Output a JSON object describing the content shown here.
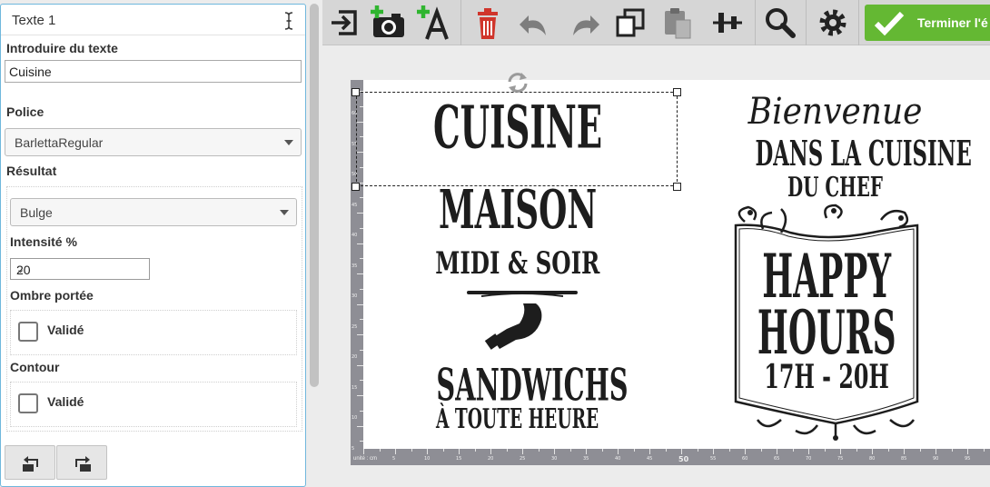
{
  "panel": {
    "title": "Texte 1",
    "text_label": "Introduire du texte",
    "text_value": "Cuisine",
    "font_label": "Police",
    "font_value": "BarlettaRegular",
    "result_label": "Résultat",
    "effect_value": "Bulge",
    "intensity_label": "Intensité %",
    "intensity_value": "20",
    "shadow_label": "Ombre portée",
    "shadow_check_label": "Validé",
    "contour_label": "Contour",
    "contour_check_label": "Validé"
  },
  "toolbar": {
    "finish_label": "Terminer l'é",
    "icons": [
      "exit-icon",
      "add-image-icon",
      "add-text-icon",
      "delete-icon",
      "undo-icon",
      "redo-icon",
      "duplicate-icon",
      "paste-icon",
      "align-icon",
      "zoom-icon",
      "settings-icon",
      "checkmark-icon"
    ]
  },
  "ruler": {
    "unit": "unité : cm",
    "bottom_labels": [
      "5",
      "10",
      "15",
      "20",
      "25",
      "30",
      "35",
      "40",
      "45",
      "50",
      "55",
      "60",
      "65",
      "70",
      "75",
      "80",
      "85",
      "90",
      "95"
    ],
    "left_labels": [
      "60",
      "55",
      "50",
      "45",
      "40",
      "35",
      "30",
      "25",
      "20",
      "15",
      "10",
      "5"
    ]
  },
  "artwork": {
    "left": {
      "line1": "CUISINE",
      "line2": "MAISON",
      "line3": "MIDI & SOIR",
      "line4": "SANDWICHS",
      "line5": "À TOUTE HEURE"
    },
    "right": {
      "script": "Bienvenue",
      "line1": "DANS LA CUISINE",
      "line2": "DU CHEF",
      "line3": "HAPPY",
      "line4": "HOURS",
      "line5": "17H - 20H"
    }
  },
  "colors": {
    "accent": "#6fb7dc",
    "finish_green": "#64b833",
    "delete_red": "#d0352b",
    "add_green": "#2fb52f",
    "ruler_gray": "#8e8e95"
  }
}
